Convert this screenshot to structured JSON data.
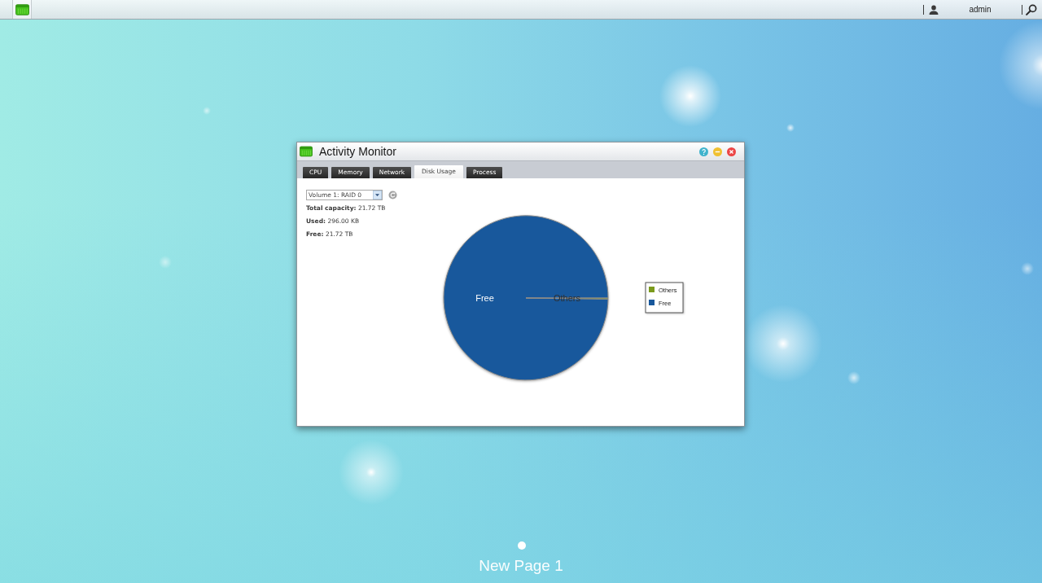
{
  "top_bar": {
    "user_name": "admin"
  },
  "window": {
    "title": "Activity Monitor",
    "tabs": [
      {
        "label": "CPU",
        "selected": false
      },
      {
        "label": "Memory",
        "selected": false
      },
      {
        "label": "Network",
        "selected": false
      },
      {
        "label": "Disk Usage",
        "selected": true
      },
      {
        "label": "Process",
        "selected": false
      }
    ],
    "volume_select": {
      "value": "Volume 1: RAID 0"
    },
    "stats": [
      "**Total capacity:** 21.72 TB",
      "**Used:** 296.00 KB",
      "**Free:** 21.72 TB"
    ],
    "chart": {
      "chart_data": {
        "type": "pie",
        "categories": [
          "Others",
          "Free"
        ],
        "values": [
          0.2,
          99.8
        ]
      },
      "legend": [
        {
          "label": "Others",
          "color": "#7b9a1c"
        },
        {
          "label": "Free",
          "color": "#18589c"
        }
      ]
    }
  },
  "desktop": {
    "page_dots": [
      {
        "selected": true
      }
    ],
    "page_title": "New Page 1"
  }
}
